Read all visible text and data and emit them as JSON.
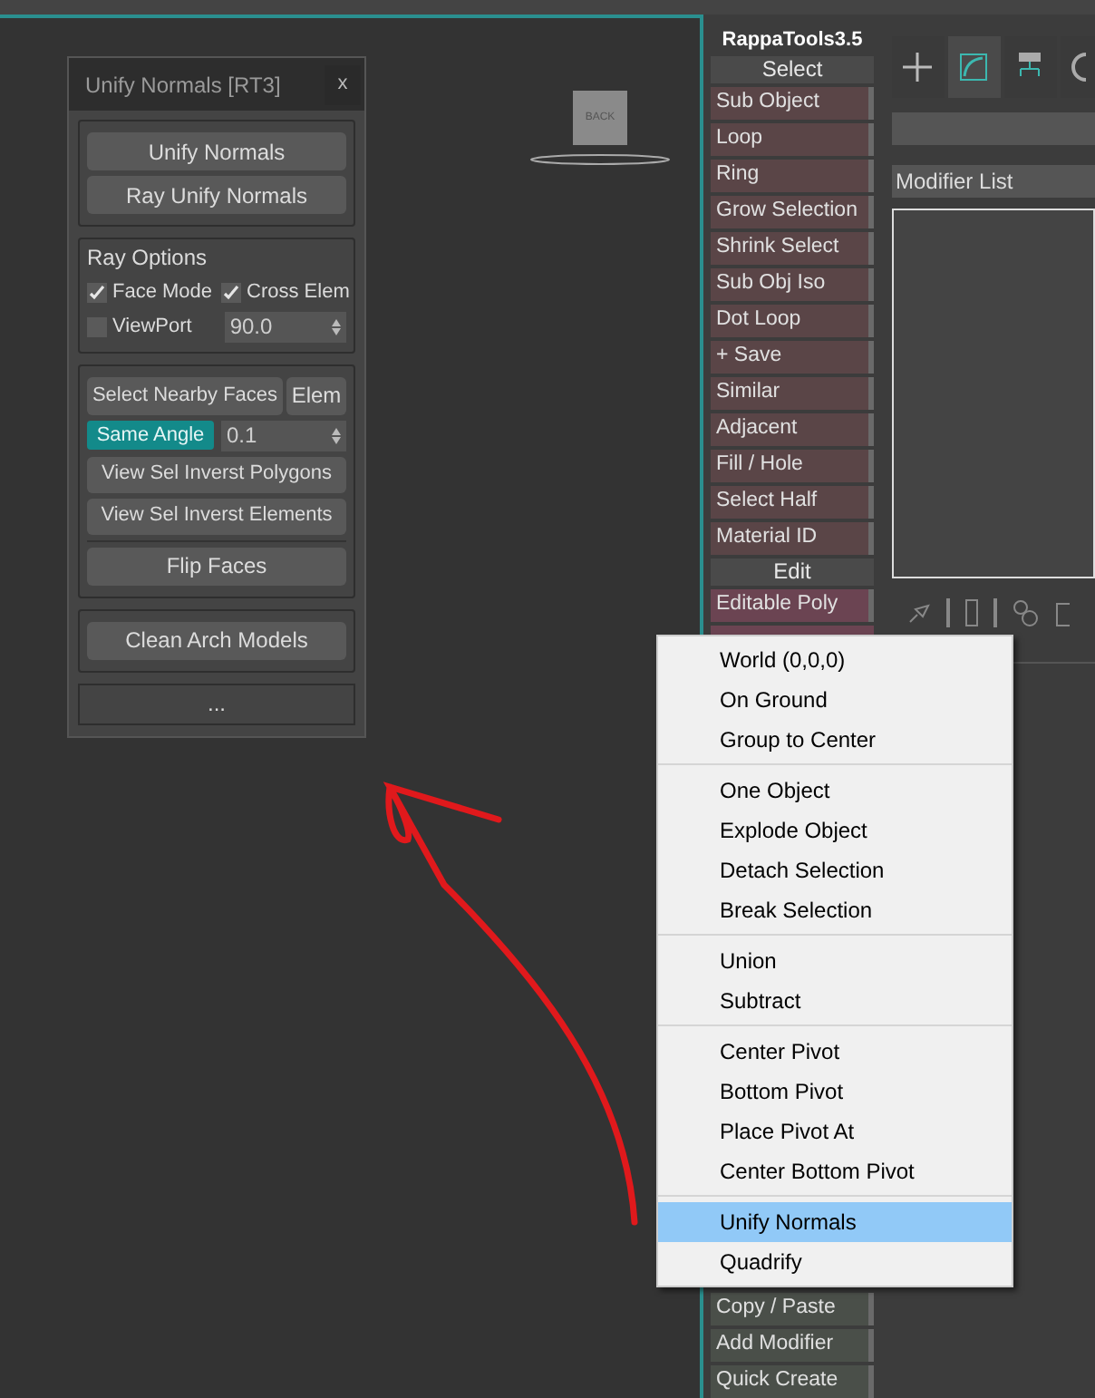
{
  "viewport": {
    "nav_cube_label": "BACK"
  },
  "floating_panel": {
    "title": "Unify Normals [RT3]",
    "close": "x",
    "top_buttons": [
      "Unify Normals",
      "Ray Unify Normals"
    ],
    "ray_options": {
      "title": "Ray Options",
      "checks": [
        {
          "label": "Face Mode",
          "checked": true
        },
        {
          "label": "Cross Elem",
          "checked": true
        },
        {
          "label": "ViewPort",
          "checked": false
        }
      ],
      "spinner": "90.0"
    },
    "select_nearby": {
      "button": "Select Nearby Faces",
      "elem": "Elem",
      "toggle": {
        "label": "Same Angle",
        "selected": true
      },
      "spinner": "0.1"
    },
    "view_buttons": [
      "View Sel Inverst Polygons",
      "View Sel Inverst Elements"
    ],
    "flip": "Flip Faces",
    "clean": "Clean Arch Models",
    "more": "..."
  },
  "rappa_tools": {
    "title": "RappaTools3.5",
    "items": [
      {
        "kind": "header",
        "label": "Select"
      },
      {
        "kind": "button",
        "label": "Sub Object",
        "color": "#5a4547"
      },
      {
        "kind": "button",
        "label": "Loop",
        "color": "#5a4547"
      },
      {
        "kind": "button",
        "label": "Ring",
        "color": "#5a4547"
      },
      {
        "kind": "button",
        "label": "Grow Selection",
        "color": "#5a4547"
      },
      {
        "kind": "button",
        "label": "Shrink Select",
        "color": "#5a4547"
      },
      {
        "kind": "button",
        "label": "Sub Obj Iso",
        "color": "#5a4547"
      },
      {
        "kind": "button",
        "label": "Dot Loop",
        "color": "#5a4547"
      },
      {
        "kind": "button",
        "label": "+ Save",
        "color": "#5a4547"
      },
      {
        "kind": "button",
        "label": "Similar",
        "color": "#5a4547"
      },
      {
        "kind": "button",
        "label": "Adjacent",
        "color": "#5a4547"
      },
      {
        "kind": "button",
        "label": "Fill / Hole",
        "color": "#5a4547"
      },
      {
        "kind": "button",
        "label": "Select Half",
        "color": "#5a4547"
      },
      {
        "kind": "button",
        "label": "Material ID",
        "color": "#5a4547"
      },
      {
        "kind": "header",
        "label": "Edit"
      },
      {
        "kind": "button",
        "label": "Editable Poly",
        "color": "#6b4452"
      }
    ],
    "bottom_items": [
      {
        "label": "Copy / Paste",
        "color": "#4a4f49"
      },
      {
        "label": "Add Modifier",
        "color": "#4a4f49"
      },
      {
        "label": "Quick Create",
        "color": "#4a4f49"
      }
    ]
  },
  "command_panel": {
    "tabs": [
      {
        "selected": false
      },
      {
        "selected": true
      },
      {
        "selected": false
      },
      {
        "selected": false
      }
    ],
    "modifier_list": "Modifier List"
  },
  "context_menu": {
    "groups": [
      [
        {
          "label": "World (0,0,0)",
          "selected": false
        },
        {
          "label": "On Ground",
          "selected": false
        },
        {
          "label": "Group to Center",
          "selected": false
        }
      ],
      [
        {
          "label": "One Object",
          "selected": false
        },
        {
          "label": "Explode Object",
          "selected": false
        },
        {
          "label": "Detach Selection",
          "selected": false
        },
        {
          "label": "Break Selection",
          "selected": false
        }
      ],
      [
        {
          "label": "Union",
          "selected": false
        },
        {
          "label": "Subtract",
          "selected": false
        }
      ],
      [
        {
          "label": "Center Pivot",
          "selected": false
        },
        {
          "label": "Bottom Pivot",
          "selected": false
        },
        {
          "label": "Place Pivot At",
          "selected": false
        },
        {
          "label": "Center Bottom Pivot",
          "selected": false
        }
      ],
      [
        {
          "label": "Unify Normals",
          "selected": true
        },
        {
          "label": "Quadrify",
          "selected": false
        }
      ]
    ]
  }
}
